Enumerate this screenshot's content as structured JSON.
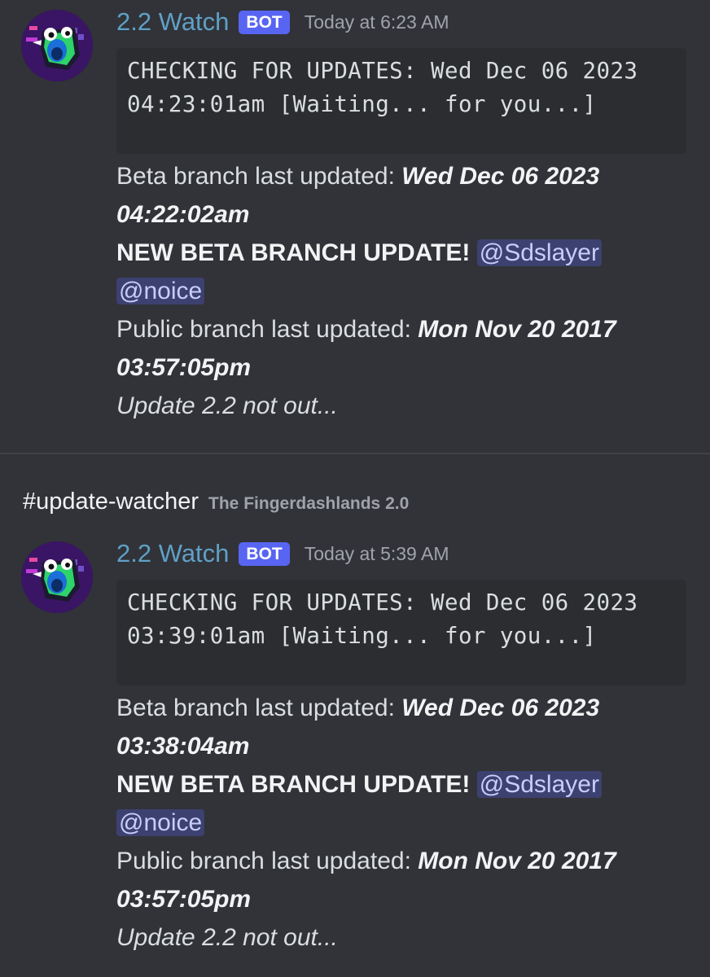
{
  "channel": {
    "name": "#update-watcher",
    "server": "The Fingerdashlands 2.0"
  },
  "messages": [
    {
      "author": "2.2 Watch",
      "badge": "BOT",
      "timestamp": "Today at 6:23 AM",
      "code": "CHECKING FOR UPDATES: Wed Dec 06 2023 04:23:01am [Waiting... for you...]",
      "beta_label": "Beta branch last updated: ",
      "beta_date": "Wed Dec 06 2023 04:22:02am",
      "new_update": "NEW BETA BRANCH UPDATE!",
      "mentions": [
        "@Sdslayer",
        "@noice"
      ],
      "public_label": "Public branch last updated: ",
      "public_date": "Mon Nov 20 2017 03:57:05pm",
      "footer": "Update 2.2 not out..."
    },
    {
      "author": "2.2 Watch",
      "badge": "BOT",
      "timestamp": "Today at 5:39 AM",
      "code": "CHECKING FOR UPDATES: Wed Dec 06 2023 03:39:01am [Waiting... for you...]",
      "beta_label": "Beta branch last updated: ",
      "beta_date": "Wed Dec 06 2023 03:38:04am",
      "new_update": "NEW BETA BRANCH UPDATE!",
      "mentions": [
        "@Sdslayer",
        "@noice"
      ],
      "public_label": "Public branch last updated: ",
      "public_date": "Mon Nov 20 2017 03:57:05pm",
      "footer": "Update 2.2 not out..."
    }
  ]
}
